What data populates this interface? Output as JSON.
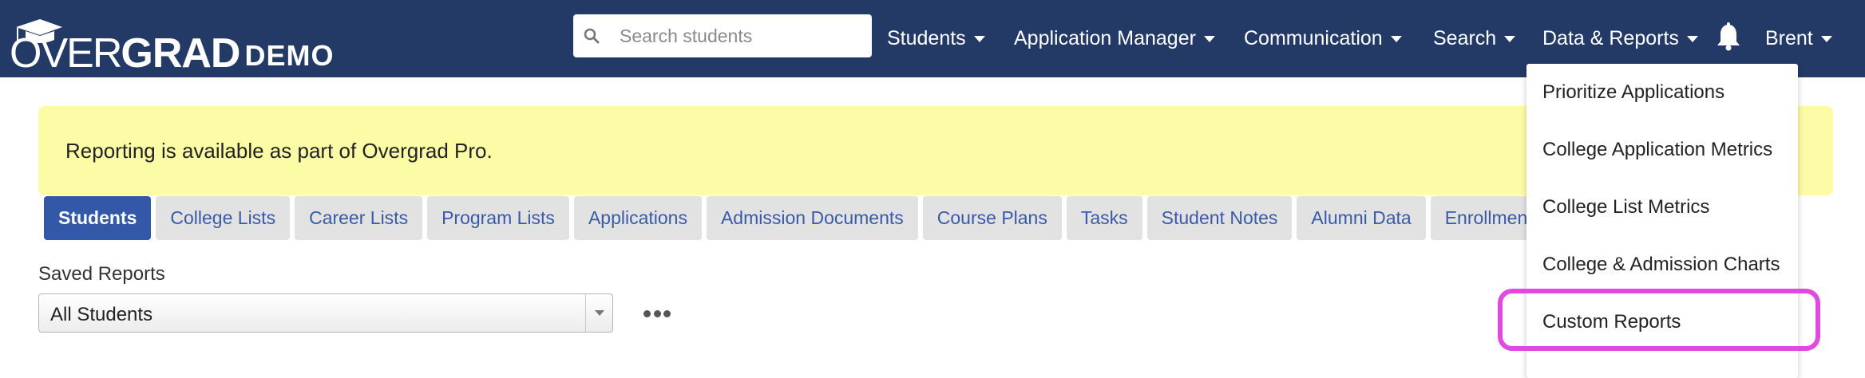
{
  "brand": {
    "word_first": "OVER",
    "word_second": "GRAD",
    "demo": "DEMO"
  },
  "search": {
    "placeholder": "Search students",
    "icon": "search-icon"
  },
  "nav": {
    "items": [
      {
        "label": "Students"
      },
      {
        "label": "Application Manager"
      },
      {
        "label": "Communication"
      },
      {
        "label": "Search"
      },
      {
        "label": "Data & Reports"
      }
    ],
    "notifications_icon": "bell-icon",
    "user": "Brent"
  },
  "alert": {
    "text": "Reporting is available as part of Overgrad Pro."
  },
  "tabs": [
    {
      "label": "Students",
      "active": true
    },
    {
      "label": "College Lists"
    },
    {
      "label": "Career Lists"
    },
    {
      "label": "Program Lists"
    },
    {
      "label": "Applications"
    },
    {
      "label": "Admission Documents"
    },
    {
      "label": "Course Plans"
    },
    {
      "label": "Tasks"
    },
    {
      "label": "Student Notes"
    },
    {
      "label": "Alumni Data"
    },
    {
      "label": "Enrollments"
    }
  ],
  "saved_reports": {
    "label": "Saved Reports",
    "selected": "All Students",
    "more_icon": "ellipsis-icon"
  },
  "dropdown": {
    "items": [
      {
        "label": "Prioritize Applications"
      },
      {
        "label": "College Application Metrics"
      },
      {
        "label": "College List Metrics"
      },
      {
        "label": "College & Admission Charts"
      },
      {
        "label": "Custom Reports",
        "highlighted": true
      }
    ]
  },
  "colors": {
    "navbar": "#233a66",
    "alert": "#fdfca6",
    "active_tab": "#3358a8",
    "tab_text": "#3a5aa8",
    "highlight": "#e04ae0"
  }
}
